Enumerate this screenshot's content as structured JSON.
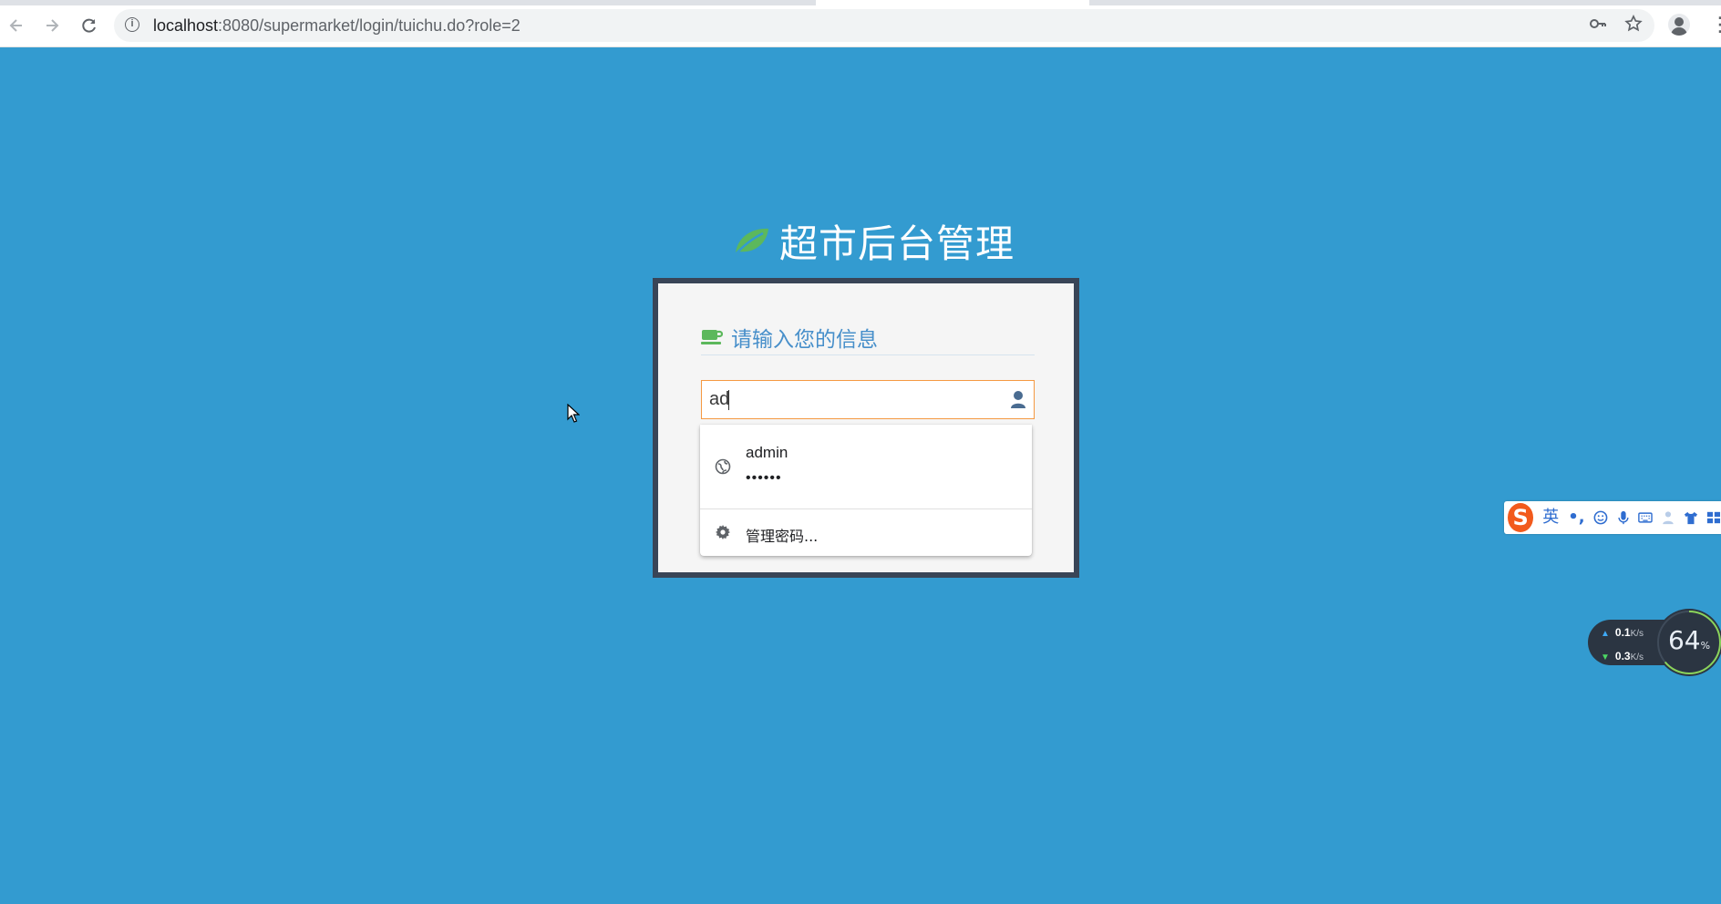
{
  "browser": {
    "url_host": "localhost",
    "url_rest": ":8080/supermarket/login/tuichu.do?role=2"
  },
  "page": {
    "title": "超市后台管理"
  },
  "login_box": {
    "header": "请输入您的信息",
    "username_value": "ad"
  },
  "autofill": {
    "suggestion_user": "admin",
    "suggestion_password": "••••••",
    "manage_label": "管理密码..."
  },
  "ime_toolbar": {
    "logo": "S",
    "mode": "英",
    "punct": "•,"
  },
  "net_widget": {
    "upload_value": "0.1",
    "upload_unit": "K/s",
    "download_value": "0.3",
    "download_unit": "K/s",
    "usage_value": "64",
    "usage_unit": "%",
    "usage_fraction": 0.64
  },
  "colors": {
    "background": "#339bd0",
    "box_frame": "#394557",
    "header_text": "#478fca",
    "leaf_green": "#5cb85c",
    "input_focus_border": "#f59942"
  },
  "icons": {
    "back": "arrow-left-icon",
    "forward": "arrow-right-icon",
    "reload": "reload-icon",
    "site_info": "info-icon",
    "key": "key-icon",
    "bookmark": "star-icon",
    "profile": "profile-icon",
    "title_logo": "leaf-icon",
    "header_logo": "coffee-cup-icon",
    "username_field": "user-icon",
    "suggestion": "globe-icon",
    "manage": "gear-icon"
  }
}
